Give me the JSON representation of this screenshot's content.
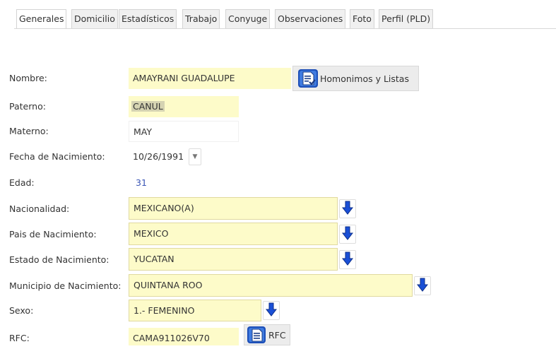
{
  "tabs": [
    {
      "label": "Generales",
      "active": true
    },
    {
      "label": "Domicilio"
    },
    {
      "label": "Estadísticos"
    },
    {
      "label": "Trabajo"
    },
    {
      "label": "Conyuge"
    },
    {
      "label": "Observaciones"
    },
    {
      "label": "Foto"
    },
    {
      "label": "Perfil (PLD)"
    }
  ],
  "form": {
    "nombre": {
      "label": "Nombre:",
      "value": "AMAYRANI GUADALUPE"
    },
    "paterno": {
      "label": "Paterno:",
      "value": "CANUL"
    },
    "materno": {
      "label": "Materno:",
      "value": "MAY"
    },
    "fecha_nacimiento": {
      "label": "Fecha de Nacimiento:",
      "value": "10/26/1991",
      "icon": "dropdown-triangle-icon"
    },
    "edad": {
      "label": "Edad:",
      "value": "31"
    },
    "nacionalidad": {
      "label": "Nacionalidad:",
      "value": "MEXICANO(A)"
    },
    "pais_nacimiento": {
      "label": "Pais de Nacimiento:",
      "value": "MEXICO"
    },
    "estado_nacimiento": {
      "label": "Estado de Nacimiento:",
      "value": "YUCATAN"
    },
    "municipio_nacimiento": {
      "label": "Municipio de Nacimiento:",
      "value": "QUINTANA ROO"
    },
    "sexo": {
      "label": "Sexo:",
      "value": "1.- FEMENINO"
    },
    "rfc": {
      "label": "RFC:",
      "value": "CAMA911026V70"
    }
  },
  "buttons": {
    "homonimos": {
      "label": "Homonimos y Listas",
      "icon": "checklist-document-icon"
    },
    "rfc": {
      "label": "RFC",
      "icon": "document-icon"
    }
  },
  "colors": {
    "field_yellow": "#fdfbc9",
    "arrow_blue": "#1a4fd6",
    "edad_blue": "#3a55b5"
  }
}
